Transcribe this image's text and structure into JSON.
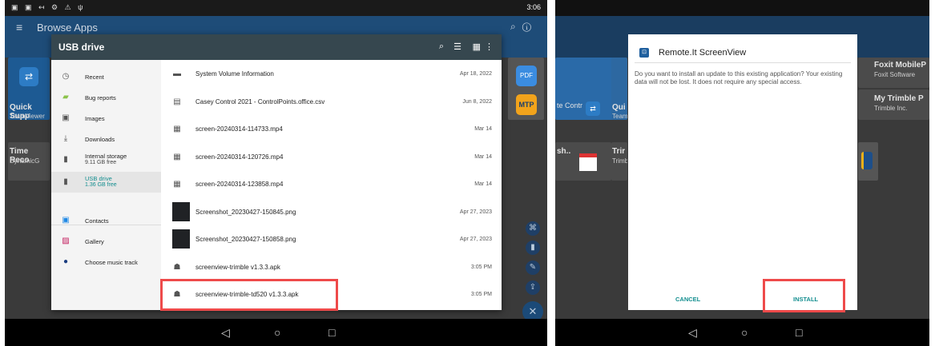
{
  "left": {
    "status": {
      "icons": "▣ ▣ ↤ ⚙ ⚠ ψ",
      "time": "3:06"
    },
    "app_title": "Browse Apps",
    "bg_tiles": [
      {
        "title": "Quick Supp",
        "sub": "TeamViewer"
      },
      {
        "title": "Time Reco",
        "sub": "DynamicG"
      },
      {
        "icon_label": "MTP"
      }
    ],
    "picker": {
      "title": "USB drive",
      "roots": [
        {
          "label": "Recent",
          "icon": "clock-icon",
          "glyph": "◷"
        },
        {
          "label": "Bug reports",
          "icon": "android-icon",
          "glyph": "▰"
        },
        {
          "label": "Images",
          "icon": "image-icon",
          "glyph": "▣"
        },
        {
          "label": "Downloads",
          "icon": "download-icon",
          "glyph": "⤓"
        },
        {
          "label": "Internal storage",
          "sub": "9.11 GB free",
          "icon": "sd-card-icon",
          "glyph": "▮"
        },
        {
          "label": "USB drive",
          "sub": "1.36 GB free",
          "icon": "usb-icon",
          "glyph": "▮"
        },
        {
          "label": "Contacts",
          "icon": "contacts-icon",
          "glyph": "▣"
        },
        {
          "label": "Gallery",
          "icon": "gallery-icon",
          "glyph": "▨"
        },
        {
          "label": "Choose music track",
          "icon": "music-icon",
          "glyph": "●"
        }
      ],
      "files": [
        {
          "name": "System Volume Information",
          "date": "Apr 18, 2022",
          "icon": "folder-icon",
          "glyph": "▬"
        },
        {
          "name": "Casey Control 2021 - ControlPoints.office.csv",
          "date": "Jun 8, 2022",
          "icon": "document-icon",
          "glyph": "▤"
        },
        {
          "name": "screen-20240314-114733.mp4",
          "date": "Mar 14",
          "icon": "video-icon",
          "glyph": "▦"
        },
        {
          "name": "screen-20240314-120726.mp4",
          "date": "Mar 14",
          "icon": "video-icon",
          "glyph": "▦"
        },
        {
          "name": "screen-20240314-123858.mp4",
          "date": "Mar 14",
          "icon": "video-icon",
          "glyph": "▦"
        },
        {
          "name": "Screenshot_20230427-150845.png",
          "date": "Apr 27, 2023",
          "icon": "thumbnail",
          "glyph": ""
        },
        {
          "name": "Screenshot_20230427-150858.png",
          "date": "Apr 27, 2023",
          "icon": "thumbnail",
          "glyph": ""
        },
        {
          "name": "screenview-trimble v1.3.3.apk",
          "date": "3:05 PM",
          "icon": "android-icon",
          "glyph": "☗"
        },
        {
          "name": "screenview-trimble-td520 v1.3.3.apk",
          "date": "3:05 PM",
          "icon": "android-icon",
          "glyph": "☗"
        }
      ]
    }
  },
  "right": {
    "status_time": "",
    "bg_tiles": [
      {
        "title": "Foxit MobileP",
        "sub": "Foxit Software"
      },
      {
        "title": "My Trimble P",
        "sub": "Trimble Inc."
      },
      {
        "title": "te Contr",
        "sub": ""
      },
      {
        "title": "Qui",
        "sub": "Team"
      },
      {
        "title": "Trir",
        "sub": "Trimb"
      },
      {
        "title": "sh..",
        "sub": ""
      }
    ],
    "dialog": {
      "title": "Remote.It ScreenView",
      "message": "Do you want to install an update to this existing application? Your existing data will not be lost. It does not require any special access.",
      "cancel": "CANCEL",
      "install": "INSTALL"
    }
  },
  "colors": {
    "accent": "#138e8f",
    "highlight": "#ee4a4a",
    "header": "#36474f"
  }
}
